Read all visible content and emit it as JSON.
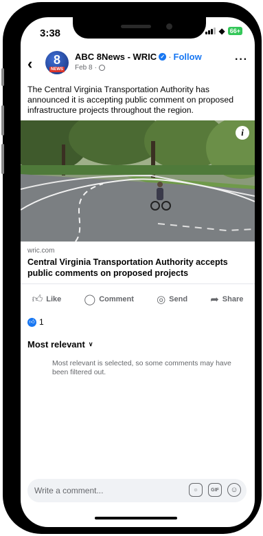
{
  "status_bar": {
    "time": "3:38",
    "battery": "66+"
  },
  "post": {
    "page_name": "ABC 8News - WRIC",
    "follow_label": "Follow",
    "date": "Feb 8",
    "avatar": {
      "number": "8",
      "badge": "NEWS"
    },
    "text": "The Central Virginia Transportation Authority has announced it is accepting public comment on proposed infrastructure projects throughout the region.",
    "link": {
      "domain": "wric.com",
      "title": "Central Virginia Transportation Authority accepts public comments on proposed projects"
    }
  },
  "actions": [
    {
      "label": "Like",
      "icon": "thumbs-up-icon"
    },
    {
      "label": "Comment",
      "icon": "comment-icon"
    },
    {
      "label": "Send",
      "icon": "messenger-icon"
    },
    {
      "label": "Share",
      "icon": "share-icon"
    }
  ],
  "reactions": {
    "count": "1"
  },
  "comments": {
    "sort_label": "Most relevant",
    "filter_note": "Most relevant is selected, so some comments may have been filtered out."
  },
  "composer": {
    "placeholder": "Write a comment...",
    "gif_label": "GIF"
  },
  "colors": {
    "brand": "#1877f2",
    "battery": "#34c759"
  }
}
